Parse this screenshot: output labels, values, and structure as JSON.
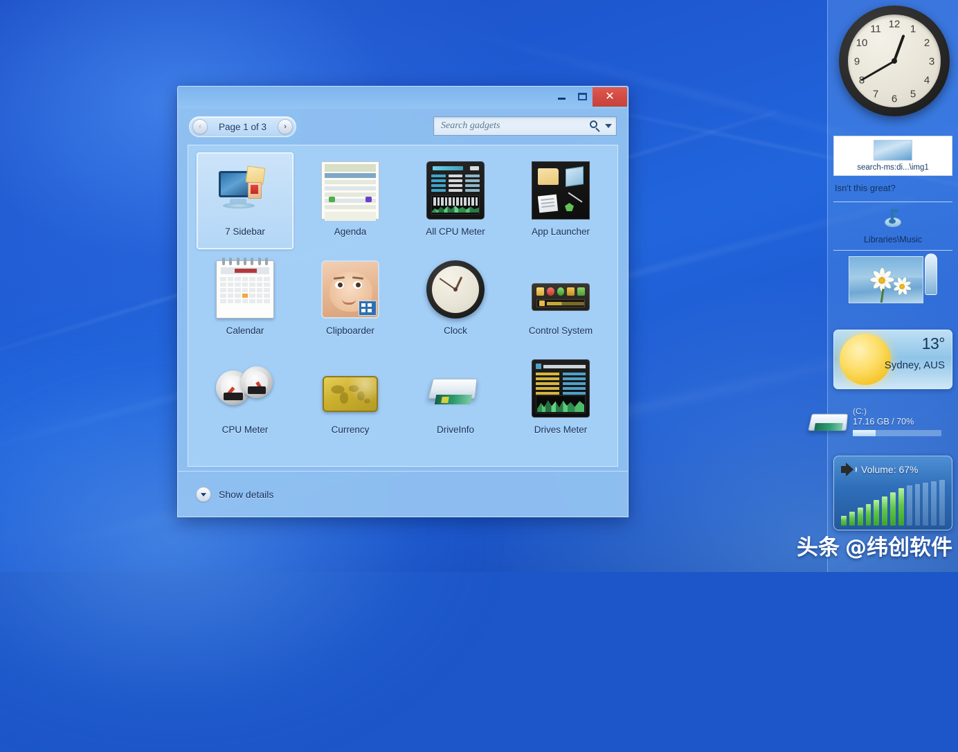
{
  "desktop": {
    "watermark_brand": "头条",
    "watermark_handle": "@纬创软件"
  },
  "window": {
    "controls": {
      "minimize_label": "–",
      "maximize_label": "□",
      "close_label": "✕"
    },
    "toolbar": {
      "prev_label": "‹",
      "next_label": "›",
      "page_label": "Page 1 of 3",
      "search_placeholder": "Search gadgets",
      "search_value": "",
      "search_icon": "magnifier-icon",
      "dropdown_icon": "chevron-down-icon"
    },
    "gadgets": [
      {
        "name": "7 Sidebar",
        "icon": "monitor-with-note-icon",
        "selected": true
      },
      {
        "name": "Agenda",
        "icon": "calendar-sheet-icon",
        "selected": false
      },
      {
        "name": "All CPU Meter",
        "icon": "cpu-meter-panel-icon",
        "selected": false
      },
      {
        "name": "App Launcher",
        "icon": "app-launcher-icon",
        "selected": false
      },
      {
        "name": "Calendar",
        "icon": "desk-calendar-icon",
        "selected": false
      },
      {
        "name": "Clipboarder",
        "icon": "baby-photo-icon",
        "selected": false
      },
      {
        "name": "Clock",
        "icon": "analog-clock-icon",
        "selected": false
      },
      {
        "name": "Control System",
        "icon": "control-bar-icon",
        "selected": false
      },
      {
        "name": "CPU Meter",
        "icon": "dual-gauge-icon",
        "selected": false
      },
      {
        "name": "Currency",
        "icon": "gold-world-map-icon",
        "selected": false
      },
      {
        "name": "DriveInfo",
        "icon": "hard-drive-icon",
        "selected": false
      },
      {
        "name": "Drives Meter",
        "icon": "drives-meter-panel-icon",
        "selected": false
      }
    ],
    "footer": {
      "details_label": "Show details",
      "details_icon": "chevron-down-icon"
    }
  },
  "sidebar": {
    "clock": {
      "numerals": [
        "12",
        "1",
        "2",
        "3",
        "4",
        "5",
        "6",
        "7",
        "8",
        "9",
        "10",
        "11"
      ],
      "hour": "12",
      "minute": "40"
    },
    "notes": {
      "thumb_path": "search-ms:di...\\img1",
      "note_text": "Isn't this great?",
      "library_label": "Libraries\\Music",
      "library_icon": "music-library-icon",
      "photo_icon": "flower-photo-icon"
    },
    "weather": {
      "temperature": "13°",
      "location": "Sydney, AUS",
      "condition_icon": "sun-icon"
    },
    "drive": {
      "drive_label": "(C:)",
      "stat": "17.16 GB / 70%",
      "used_percent": 70,
      "icon": "hard-drive-icon"
    },
    "volume": {
      "title": "Volume: 67%",
      "level_percent": 67,
      "bars_total": 13,
      "bars_on": 8,
      "icon": "speaker-icon"
    }
  },
  "colors": {
    "accent_blue": "#1f5ad2",
    "close_red": "#cf4a42",
    "window_chrome": "#96c5f2",
    "text_dark": "#14305a",
    "volume_green": "#62c64a",
    "weather_sun": "#f5c52c"
  }
}
